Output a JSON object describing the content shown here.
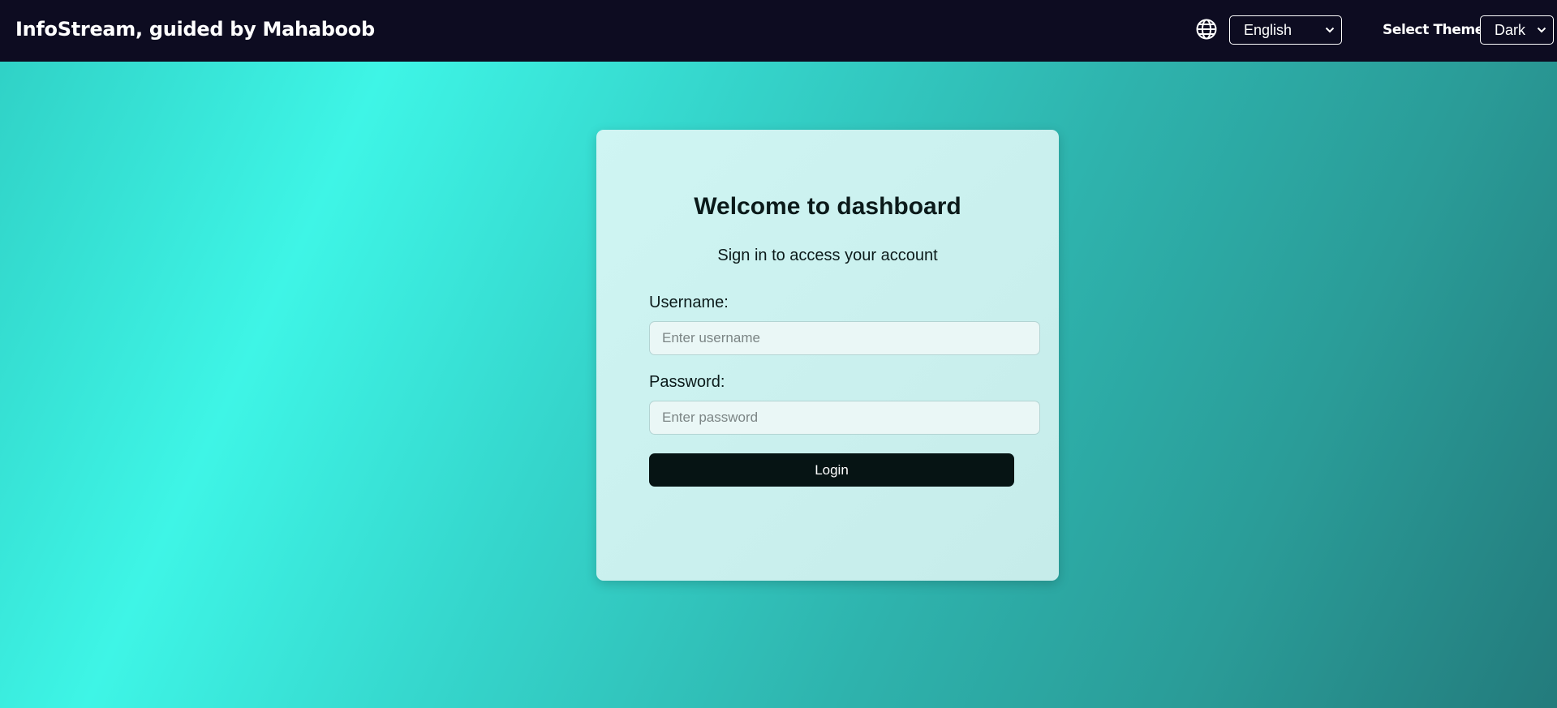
{
  "header": {
    "brand": "InfoStream, guided by Mahaboob",
    "language_icon": "globe-icon",
    "language_value": "English",
    "theme_label": "Select Theme",
    "theme_value": "Dark"
  },
  "login": {
    "title": "Welcome to dashboard",
    "subtitle": "Sign in to access your account",
    "username_label": "Username:",
    "username_placeholder": "Enter username",
    "password_label": "Password:",
    "password_placeholder": "Enter password",
    "login_button": "Login"
  },
  "colors": {
    "header_bg": "#0d0c21",
    "page_gradient_start": "#3ef5e6",
    "page_gradient_end": "#237b7c",
    "button_bg": "#061414"
  }
}
